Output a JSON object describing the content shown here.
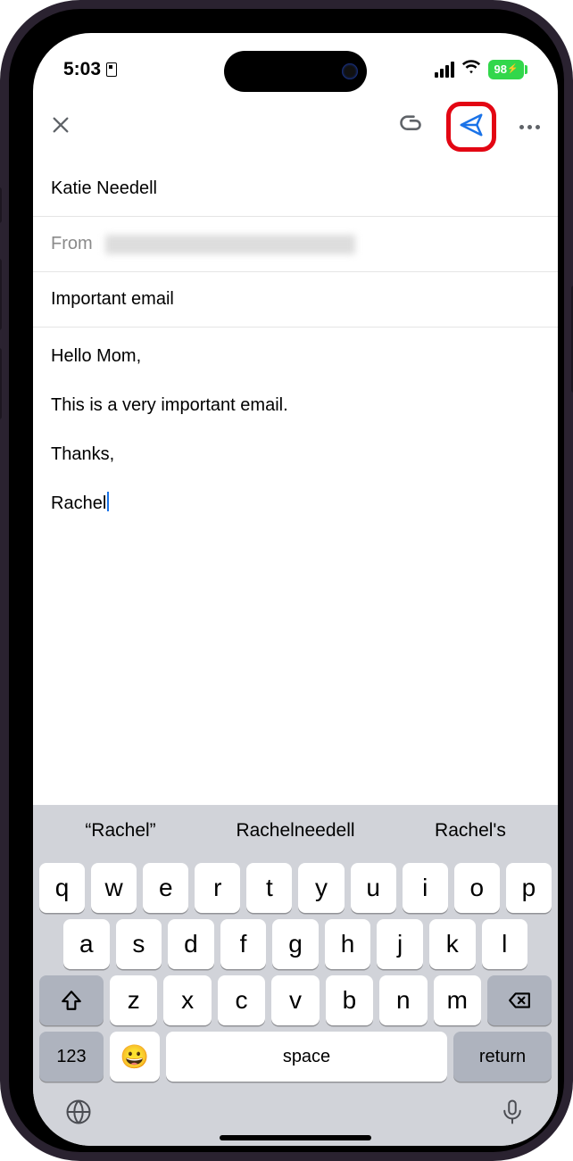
{
  "status": {
    "time": "5:03",
    "battery_pct": "98",
    "battery_extra": "⚡"
  },
  "compose": {
    "to": "Katie Needell",
    "from_label": "From",
    "subject": "Important email",
    "body_line1": "Hello Mom,",
    "body_line2": "This is a very important email.",
    "body_line3": "Thanks,",
    "body_line4": "Rachel"
  },
  "suggestions": {
    "s1": "“Rachel”",
    "s2": "Rachelneedell",
    "s3": "Rachel's"
  },
  "keys": {
    "row1": [
      "q",
      "w",
      "e",
      "r",
      "t",
      "y",
      "u",
      "i",
      "o",
      "p"
    ],
    "row2": [
      "a",
      "s",
      "d",
      "f",
      "g",
      "h",
      "j",
      "k",
      "l"
    ],
    "row3": [
      "z",
      "x",
      "c",
      "v",
      "b",
      "n",
      "m"
    ],
    "num": "123",
    "space": "space",
    "return": "return"
  },
  "annotation": {
    "send_highlight": true
  }
}
